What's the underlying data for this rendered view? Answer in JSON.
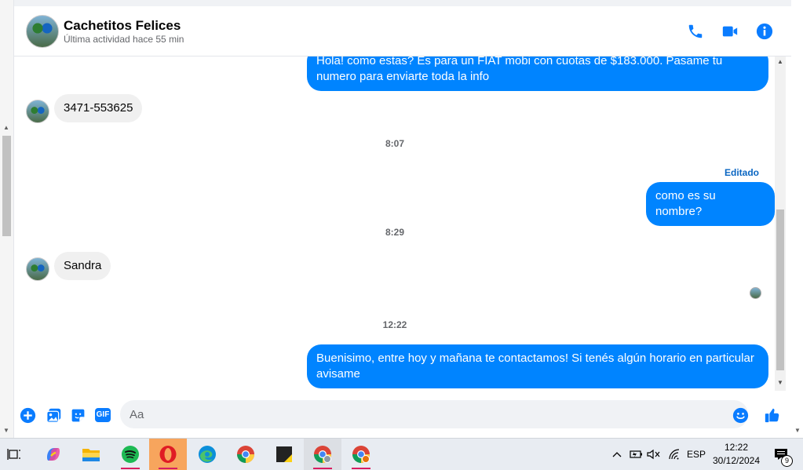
{
  "header": {
    "contact_name": "Cachetitos Felices",
    "status": "Última actividad hace 55 min",
    "call_icon": "phone-icon",
    "video_icon": "video-camera-icon",
    "info_icon": "info-icon"
  },
  "messages": [
    {
      "dir": "out",
      "text": "Hola! como estas? Es para un FIAT mobi con cuotas de $183.000. Pasame tu numero para enviarte toda la info"
    },
    {
      "dir": "in",
      "text": "3471-553625"
    },
    {
      "dir": "time",
      "text": "8:07"
    },
    {
      "dir": "edited",
      "text": "Editado"
    },
    {
      "dir": "out",
      "text": "como es su nombre?"
    },
    {
      "dir": "time",
      "text": "8:29"
    },
    {
      "dir": "in",
      "text": "Sandra"
    },
    {
      "dir": "time",
      "text": "12:22"
    },
    {
      "dir": "out",
      "text": "Buenisimo, entre hoy y mañana te contactamos! Si tenés algún horario en particular avisame"
    }
  ],
  "composer": {
    "placeholder": "Aa",
    "add_icon": "plus-circle-icon",
    "gallery_icon": "image-gallery-icon",
    "sticker_icon": "sticker-icon",
    "gif_label": "GIF",
    "emoji_icon": "emoji-icon",
    "like_icon": "thumbs-up-icon"
  },
  "taskbar": {
    "apps": [
      "task-view-icon",
      "copilot-icon",
      "file-explorer-icon",
      "spotify-icon",
      "opera-icon",
      "edge-icon",
      "chrome-icon",
      "sticky-notes-icon",
      "chrome-profile-icon",
      "chrome-alert-icon"
    ],
    "language": "ESP",
    "time": "12:22",
    "date": "30/12/2024",
    "notification_count": "9"
  },
  "colors": {
    "accent": "#0084ff",
    "incoming_bubble": "#f0f0f0",
    "icon_blue": "#0a7cff"
  }
}
